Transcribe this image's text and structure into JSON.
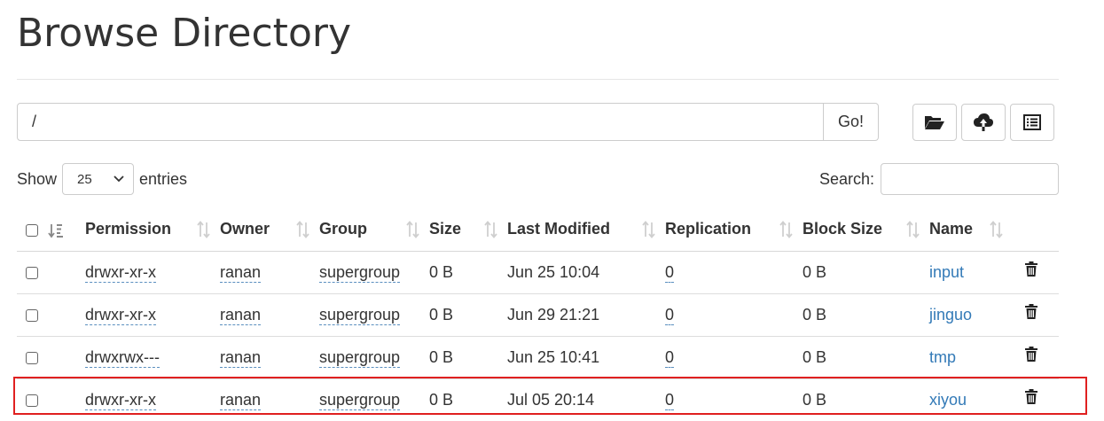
{
  "page": {
    "title": "Browse Directory"
  },
  "path_bar": {
    "value": "/",
    "go_label": "Go!"
  },
  "toolbar": {
    "buttons": [
      {
        "icon": "folder-open-icon"
      },
      {
        "icon": "cloud-upload-icon"
      },
      {
        "icon": "list-icon"
      }
    ]
  },
  "table_controls": {
    "show_label": "Show",
    "page_size": "25",
    "entries_label": "entries",
    "search_label": "Search:",
    "search_value": ""
  },
  "columns": [
    "Permission",
    "Owner",
    "Group",
    "Size",
    "Last Modified",
    "Replication",
    "Block Size",
    "Name"
  ],
  "rows": [
    {
      "permission": "drwxr-xr-x",
      "owner": "ranan",
      "group": "supergroup",
      "size": "0 B",
      "modified": "Jun 25 10:04",
      "replication": "0",
      "block_size": "0 B",
      "name": "input"
    },
    {
      "permission": "drwxr-xr-x",
      "owner": "ranan",
      "group": "supergroup",
      "size": "0 B",
      "modified": "Jun 29 21:21",
      "replication": "0",
      "block_size": "0 B",
      "name": "jinguo"
    },
    {
      "permission": "drwxrwx---",
      "owner": "ranan",
      "group": "supergroup",
      "size": "0 B",
      "modified": "Jun 25 10:41",
      "replication": "0",
      "block_size": "0 B",
      "name": "tmp"
    },
    {
      "permission": "drwxr-xr-x",
      "owner": "ranan",
      "group": "supergroup",
      "size": "0 B",
      "modified": "Jul 05 20:14",
      "replication": "0",
      "block_size": "0 B",
      "name": "xiyou"
    }
  ],
  "colors": {
    "link": "#337ab7",
    "highlight": "#e02020",
    "border": "#cccccc"
  }
}
